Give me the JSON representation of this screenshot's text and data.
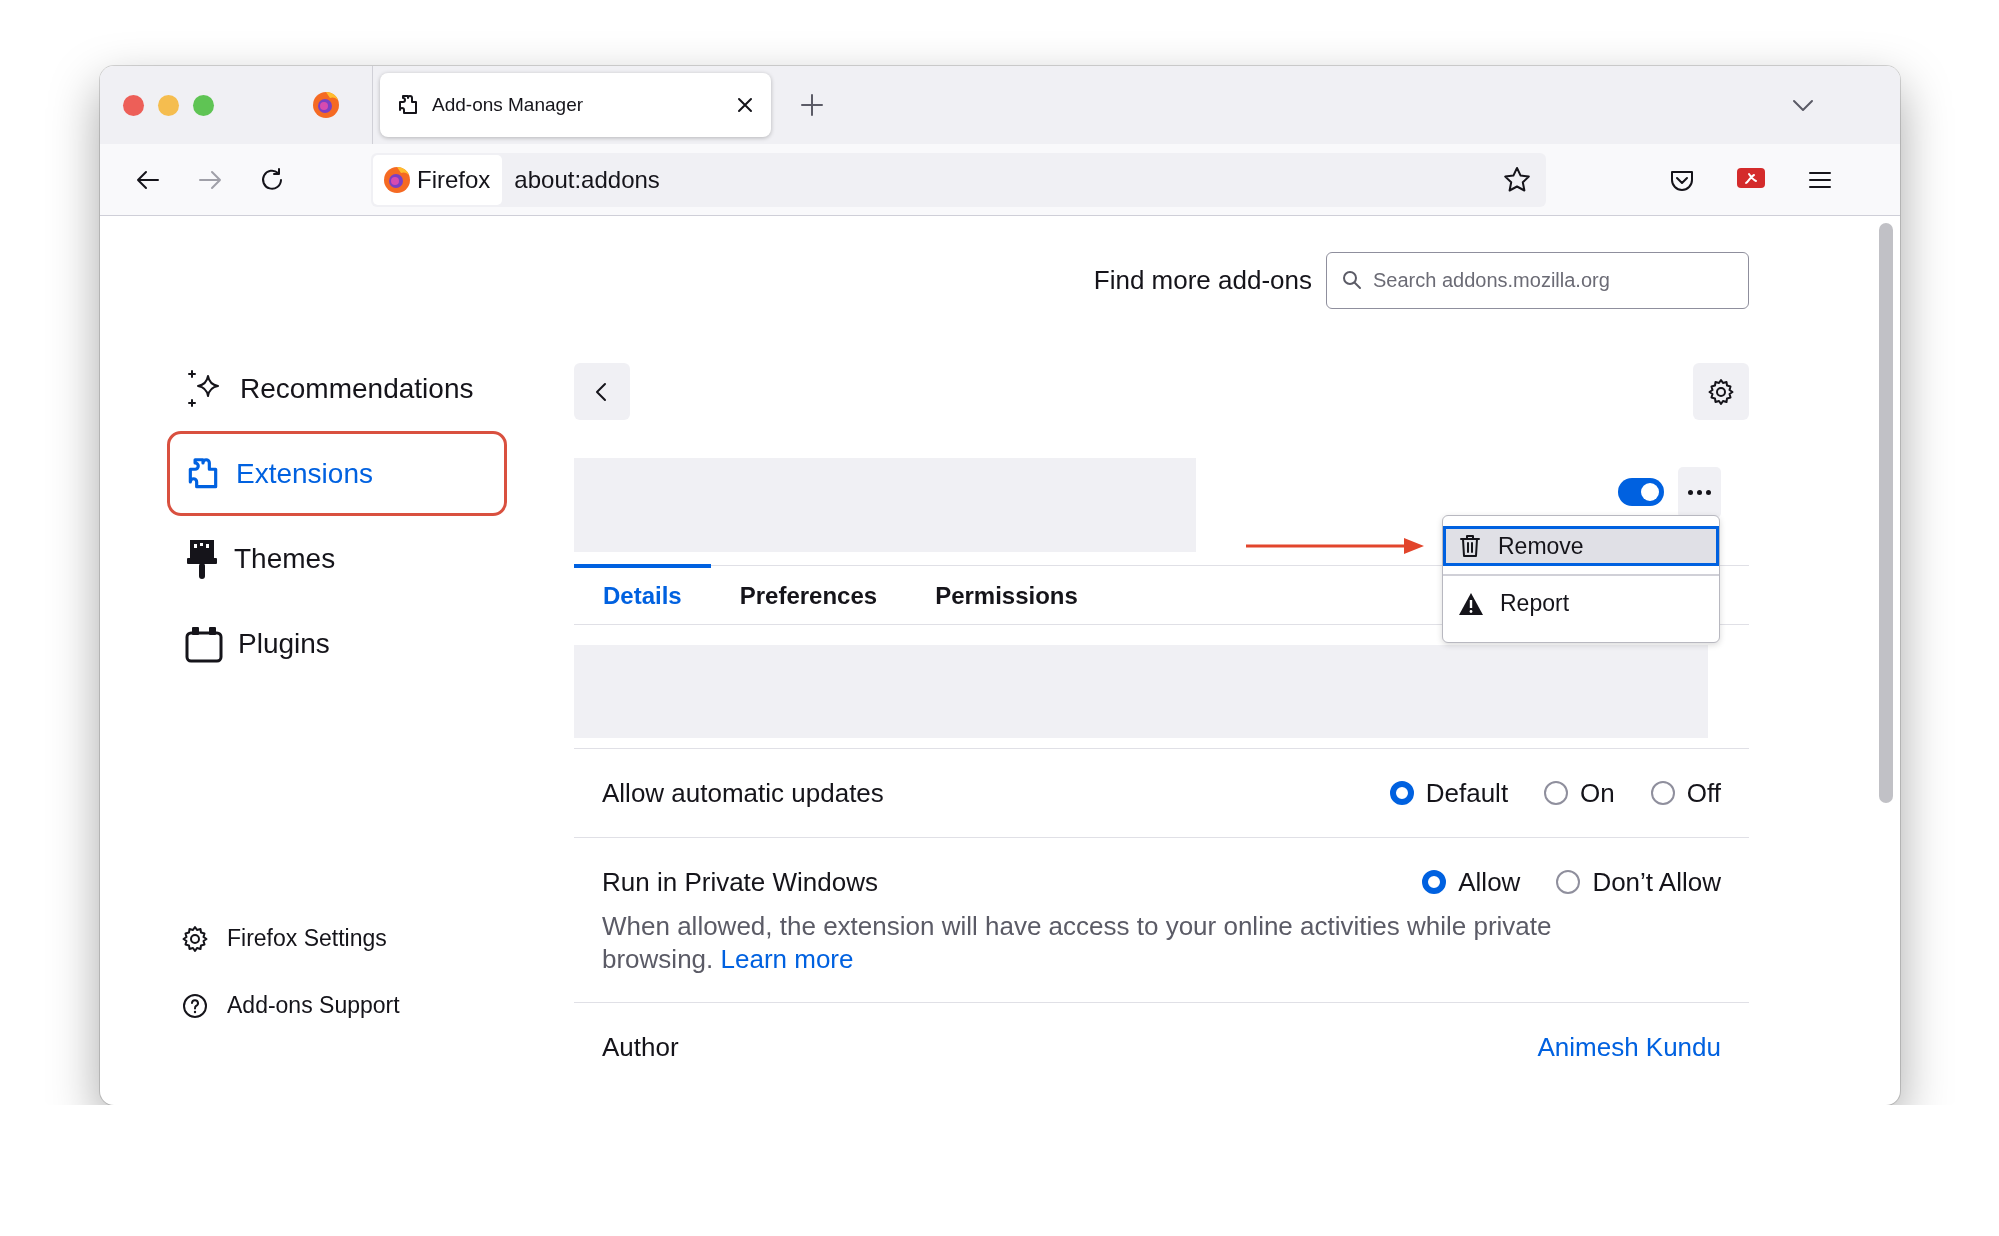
{
  "tabs": [
    {
      "title": "Add-ons Manager",
      "selected": true
    }
  ],
  "address_bar": {
    "identity": "Firefox",
    "url": "about:addons"
  },
  "header": {
    "find_label": "Find more add-ons",
    "search": {
      "placeholder": "Search addons.mozilla.org"
    }
  },
  "sidebar": {
    "items": [
      {
        "label": "Recommendations",
        "kind": "recommendations",
        "selected": false,
        "annotated": false
      },
      {
        "label": "Extensions",
        "kind": "extensions",
        "selected": true,
        "annotated": true
      },
      {
        "label": "Themes",
        "kind": "themes",
        "selected": false,
        "annotated": false
      },
      {
        "label": "Plugins",
        "kind": "plugins",
        "selected": false,
        "annotated": false
      }
    ],
    "footer": [
      {
        "label": "Firefox Settings",
        "kind": "settings"
      },
      {
        "label": "Add-ons Support",
        "kind": "support"
      }
    ]
  },
  "addon": {
    "enabled": true,
    "menu": {
      "pointer_arrow": true,
      "items": [
        {
          "label": "Remove",
          "kind": "remove",
          "selected": true
        },
        {
          "label": "Report",
          "kind": "report",
          "selected": false
        }
      ]
    },
    "tabs": [
      {
        "label": "Details",
        "selected": true
      },
      {
        "label": "Preferences",
        "selected": false
      },
      {
        "label": "Permissions",
        "selected": false
      }
    ],
    "settings": [
      {
        "kind": "radio",
        "label": "Allow automatic updates",
        "options": [
          {
            "label": "Default",
            "selected": true
          },
          {
            "label": "On",
            "selected": false
          },
          {
            "label": "Off",
            "selected": false
          }
        ]
      },
      {
        "kind": "radio",
        "label": "Run in Private Windows",
        "options": [
          {
            "label": "Allow",
            "selected": true
          },
          {
            "label": "Don’t Allow",
            "selected": false
          }
        ],
        "description": "When allowed, the extension will have access to your online activities while private browsing.",
        "link": "Learn more"
      },
      {
        "kind": "link",
        "label": "Author",
        "value": "Animesh Kundu"
      }
    ]
  }
}
